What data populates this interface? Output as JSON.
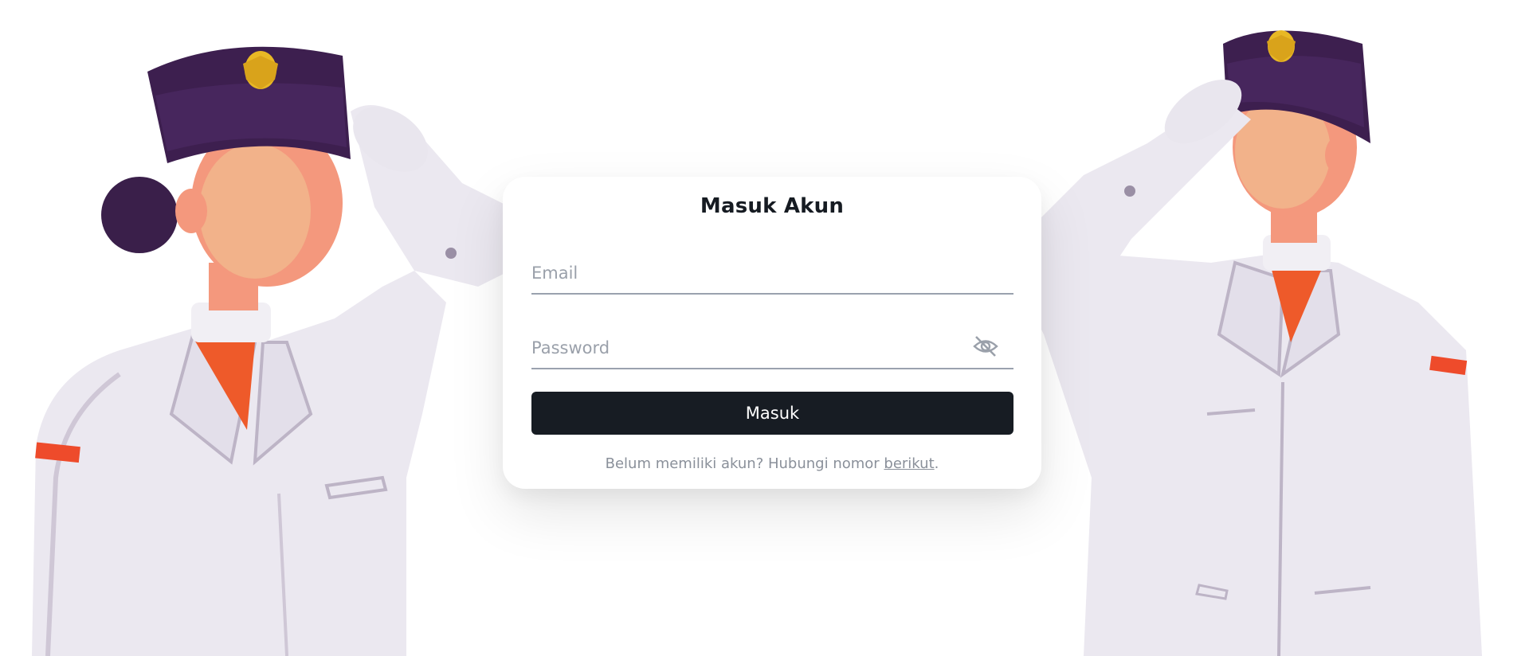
{
  "login": {
    "title": "Masuk Akun",
    "email_placeholder": "Email",
    "email_value": "",
    "password_placeholder": "Password",
    "password_value": "",
    "submit_label": "Masuk",
    "footer_text": "Belum memiliki akun? Hubungi nomor ",
    "footer_link": "berikut",
    "footer_end": "."
  },
  "icons": {
    "password_toggle": "eye-slash-icon"
  },
  "colors": {
    "button_bg": "#171c23",
    "underline": "#9aa2ae",
    "placeholder": "#9aa0aa",
    "hat": "#3a1f4a",
    "emblem": "#e8b825",
    "uniform": "#e9e6ee",
    "scarf": "#ee5a2a",
    "skin": "#f2b28a"
  }
}
